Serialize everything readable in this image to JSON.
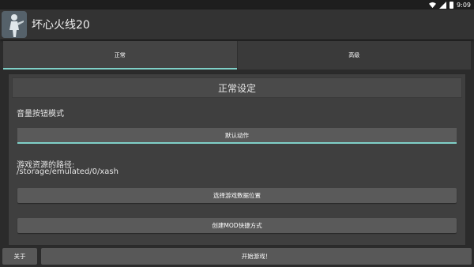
{
  "status": {
    "time": "9:09"
  },
  "app": {
    "title": "坏心火线20"
  },
  "tabs": [
    {
      "label": "正常"
    },
    {
      "label": "高级"
    }
  ],
  "main": {
    "section_title": "正常设定",
    "volume_label": "音量按钮模式",
    "volume_value": "默认动作",
    "path_label": "游戏资源的路径:",
    "path_value": "/storage/emulated/0/xash",
    "choose_data_button": "选择游戏数据位置",
    "create_shortcut_button": "创建MOD快捷方式"
  },
  "bottom": {
    "about_button": "关于",
    "start_button": "开始游戏！"
  }
}
